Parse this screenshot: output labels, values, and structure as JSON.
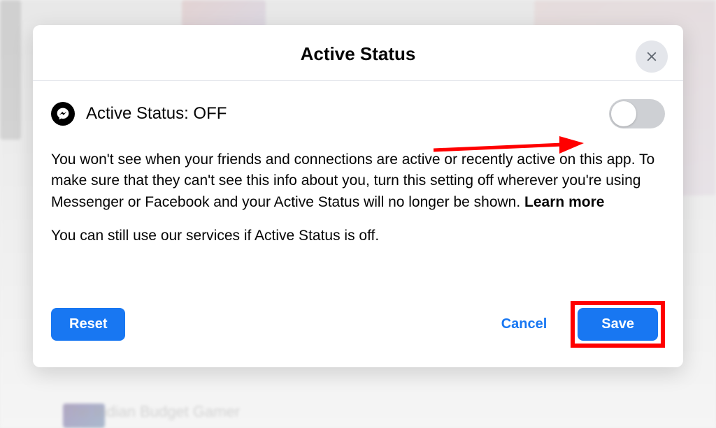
{
  "modal": {
    "title": "Active Status",
    "status_label": "Active Status: OFF",
    "description": "You won't see when your friends and connections are active or recently active on this app. To make sure that they can't see this info about you, turn this setting off wherever you're using Messenger or Facebook and your Active Status will no longer be shown. ",
    "learn_more": "Learn more",
    "sub_description": "You can still use our services if Active Status is off.",
    "toggle_state": "off",
    "buttons": {
      "reset": "Reset",
      "cancel": "Cancel",
      "save": "Save"
    }
  },
  "background": {
    "suggestion_text": "The Indian Budget Gamer"
  }
}
